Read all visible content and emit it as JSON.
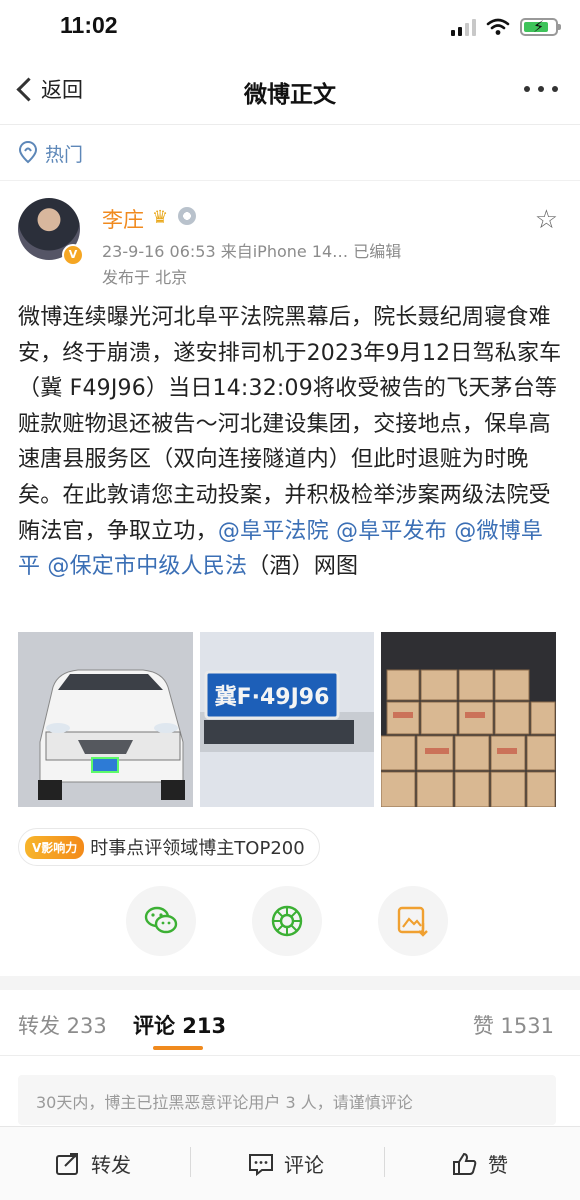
{
  "status_bar": {
    "time": "11:02"
  },
  "nav": {
    "back_label": "返回",
    "title": "微博正文"
  },
  "hot": {
    "label": "热门"
  },
  "post": {
    "username": "李庄",
    "meta": "23-9-16 06:53  来自iPhone 14…  已编辑",
    "location": "发布于 北京",
    "text_parts": {
      "main": "微博连续曝光河北阜平法院黑幕后，院长聂纪周寝食难安，终于崩溃，遂安排司机于2023年9月12日驾私家车（冀 F49J96）当日14:32:09将收受被告的飞天茅台等赃款赃物退还被告～河北建设集团，交接地点，保阜高速唐县服务区（双向连接隧道内）但此时退赃为时晚矣。在此敦请您主动投案，并积极检举涉案两级法院受贿法官，争取立功，",
      "mention1": "@阜平法院",
      "mention2": "@阜平发布",
      "mention3": "@微博阜平",
      "mention4": "@保定市中级人民法",
      "tail": "（酒）网图"
    },
    "plate_text": "冀F·49J96",
    "influence_tag": "V影响力",
    "influence_text": "时事点评领域博主TOP200"
  },
  "tabs": {
    "forward": "转发 233",
    "comment": "评论 213",
    "like": "赞 1531"
  },
  "notice": "30天内，博主已拉黑恶意评论用户 3 人，请谨慎评论",
  "bottom_bar": {
    "forward": "转发",
    "comment": "评论",
    "like": "赞"
  },
  "colors": {
    "accent": "#f08a1e",
    "mention": "#3b6fb5",
    "hot": "#5d87b8"
  }
}
